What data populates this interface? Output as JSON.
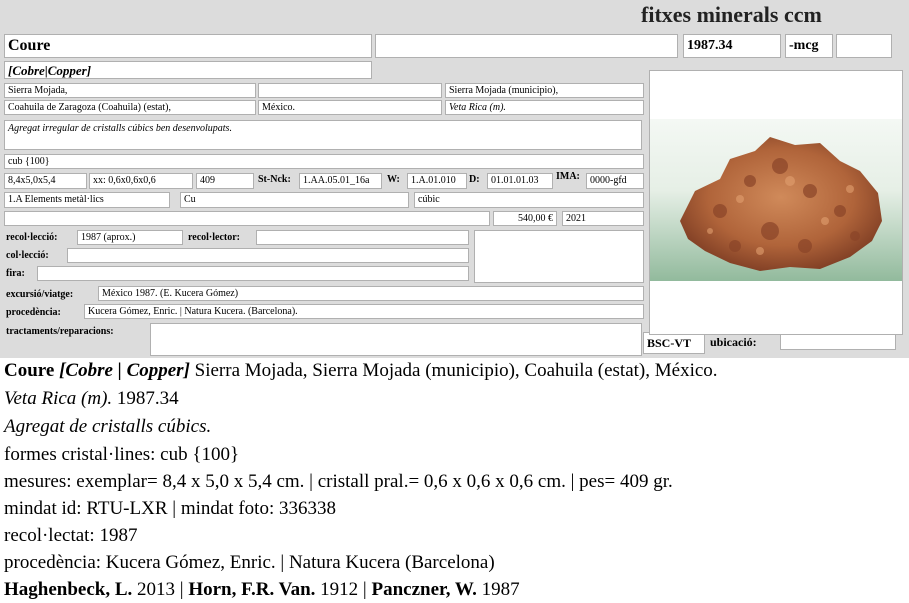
{
  "header": {
    "title": "fitxes minerals ccm"
  },
  "record": {
    "name": "Coure",
    "blank1": "",
    "number": "1987.34",
    "suffix": "-mcg",
    "blank2": "",
    "synonyms": "[Cobre|Copper]",
    "loc1": "Sierra Mojada,",
    "loc2": "",
    "loc3": "Sierra Mojada (municipio),",
    "loc4": "Coahuila de Zaragoza (Coahuila) (estat),",
    "loc5": "México.",
    "loc6": "Veta Rica (m).",
    "description": "Agregat irregular de cristalls cúbics ben desenvolupats.",
    "forms": "cub {100}",
    "size": "8,4x5,0x5,4",
    "crystal_size": "xx: 0,6x0,6x0,6",
    "weight": "409",
    "stnck_label": "St-Nck:",
    "stnck": "1.AA.05.01_16a",
    "w_label": "W:",
    "w": "1.A.01.010",
    "d_label": "D:",
    "d": "01.01.01.03",
    "ima_label": "IMA:",
    "ima": "0000-gfd",
    "class": "1.A Elements metàl·lics",
    "formula": "Cu",
    "system": "cúbic",
    "blank3": "",
    "price": "540,00 €",
    "year": "2021",
    "recollecio_label": "recol·lecció:",
    "recollecio": "1987 (aprox.)",
    "recollector_label": "recol·lector:",
    "recollector": "",
    "colleccio_label": "col·lecció:",
    "colleccio": "",
    "fira_label": "fira:",
    "fira": "",
    "excursio_label": "excursió/viatge:",
    "excursio": "México 1987. (E. Kucera Gómez)",
    "procedencia_label": "procedència:",
    "procedencia": "Kucera Gómez, Enric. | Natura Kucera. (Barcelona).",
    "tractaments_label": "tractaments/reparacions:",
    "tractaments": "",
    "bsc": "BSC-VT",
    "ubicacio_label": "ubicació:",
    "ubicacio": ""
  },
  "summary": {
    "name": "Coure",
    "synonyms": "[Cobre | Copper]",
    "locality": " Sierra Mojada, Sierra Mojada (municipio), Coahuila (estat), México.",
    "mine": "Veta Rica (m).",
    "number": " 1987.34",
    "description": "Agregat de cristalls cúbics.",
    "forms": "formes cristal·lines: cub {100}",
    "measures": "mesures: exemplar= 8,4 x 5,0 x 5,4 cm. |  cristall pral.=  0,6 x 0,6 x 0,6 cm. | pes= 409 gr.",
    "mindat": "mindat id: RTU-LXR | mindat foto: 336338",
    "collected": "recol·lectat: 1987",
    "provenance": "procedència: Kucera Gómez, Enric. | Natura Kucera  (Barcelona)",
    "refs": [
      {
        "author": "Haghenbeck, L.",
        "year": " 2013 | "
      },
      {
        "author": "Horn, F.R. Van.",
        "year": " 1912 | "
      },
      {
        "author": "Panczner, W.",
        "year": " 1987"
      }
    ]
  },
  "colors": {
    "card_bg": "#dcdcdc",
    "field_border": "#b0b0b0",
    "copper": "#b0643a"
  },
  "icons": {
    "photo": "copper-specimen-image"
  }
}
